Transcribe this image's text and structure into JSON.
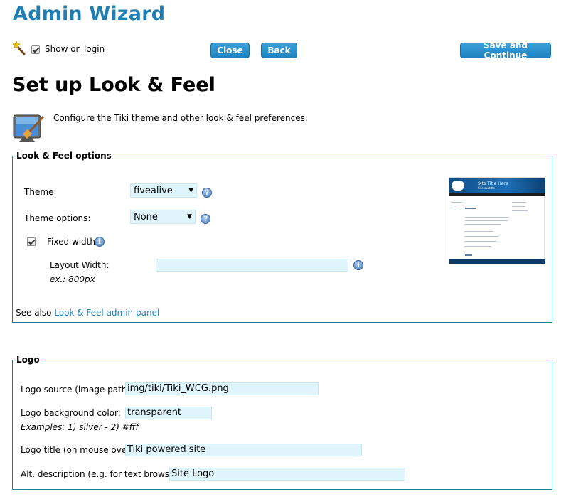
{
  "header": {
    "title": "Admin Wizard"
  },
  "toolbar": {
    "show_on_login_label": "Show on login",
    "show_on_login_checked": true,
    "close_label": "Close",
    "back_label": "Back",
    "save_continue_label": "Save and Continue"
  },
  "page": {
    "heading": "Set up Look & Feel",
    "description": "Configure the Tiki theme and other look & feel preferences."
  },
  "look_feel": {
    "legend": "Look & Feel options",
    "theme_label": "Theme:",
    "theme_value": "fivealive",
    "theme_options_label": "Theme options:",
    "theme_options_value": "None",
    "fixed_width_label": "Fixed width",
    "fixed_width_checked": true,
    "layout_width_label": "Layout Width:",
    "layout_width_value": "",
    "layout_width_example": "ex.: 800px",
    "see_also_prefix": "See also",
    "see_also_link": "Look & Feel admin panel",
    "preview": {
      "site_title": "Site Title Here",
      "site_subtitle": "Site subtitle"
    }
  },
  "logo": {
    "legend": "Logo",
    "source_label": "Logo source (image path):",
    "source_value": "img/tiki/Tiki_WCG.png",
    "bg_label": "Logo background color:",
    "bg_value": "transparent",
    "bg_examples": "Examples: 1) silver - 2) #fff",
    "title_label": "Logo title (on mouse over):",
    "title_value": "Tiki powered site",
    "alt_label": "Alt. description (e.g. for text browsers):",
    "alt_value": "Site Logo"
  },
  "colors": {
    "accent": "#1f7fb5",
    "button": "#2a8fcd",
    "input_bg": "#dff5fb",
    "border": "#1f7f9a"
  }
}
